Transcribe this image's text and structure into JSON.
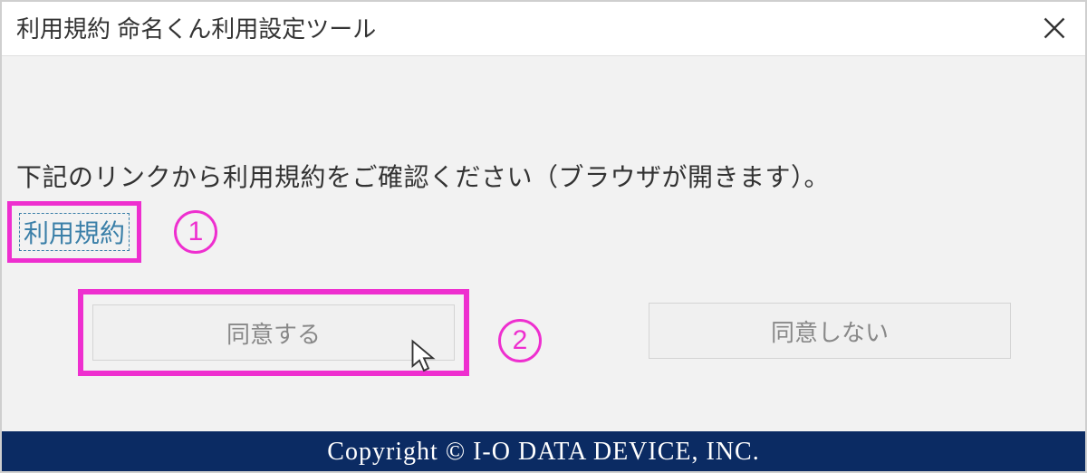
{
  "titlebar": {
    "title": "利用規約 命名くん利用設定ツール"
  },
  "content": {
    "instruction": "下記のリンクから利用規約をご確認ください（ブラウザが開きます）。",
    "terms_link": "利用規約",
    "step1": "1",
    "step2": "2"
  },
  "buttons": {
    "agree": "同意する",
    "decline": "同意しない"
  },
  "footer": {
    "copyright": "Copyright © I-O DATA DEVICE, INC."
  },
  "annotation_color": "#ee2fcf"
}
